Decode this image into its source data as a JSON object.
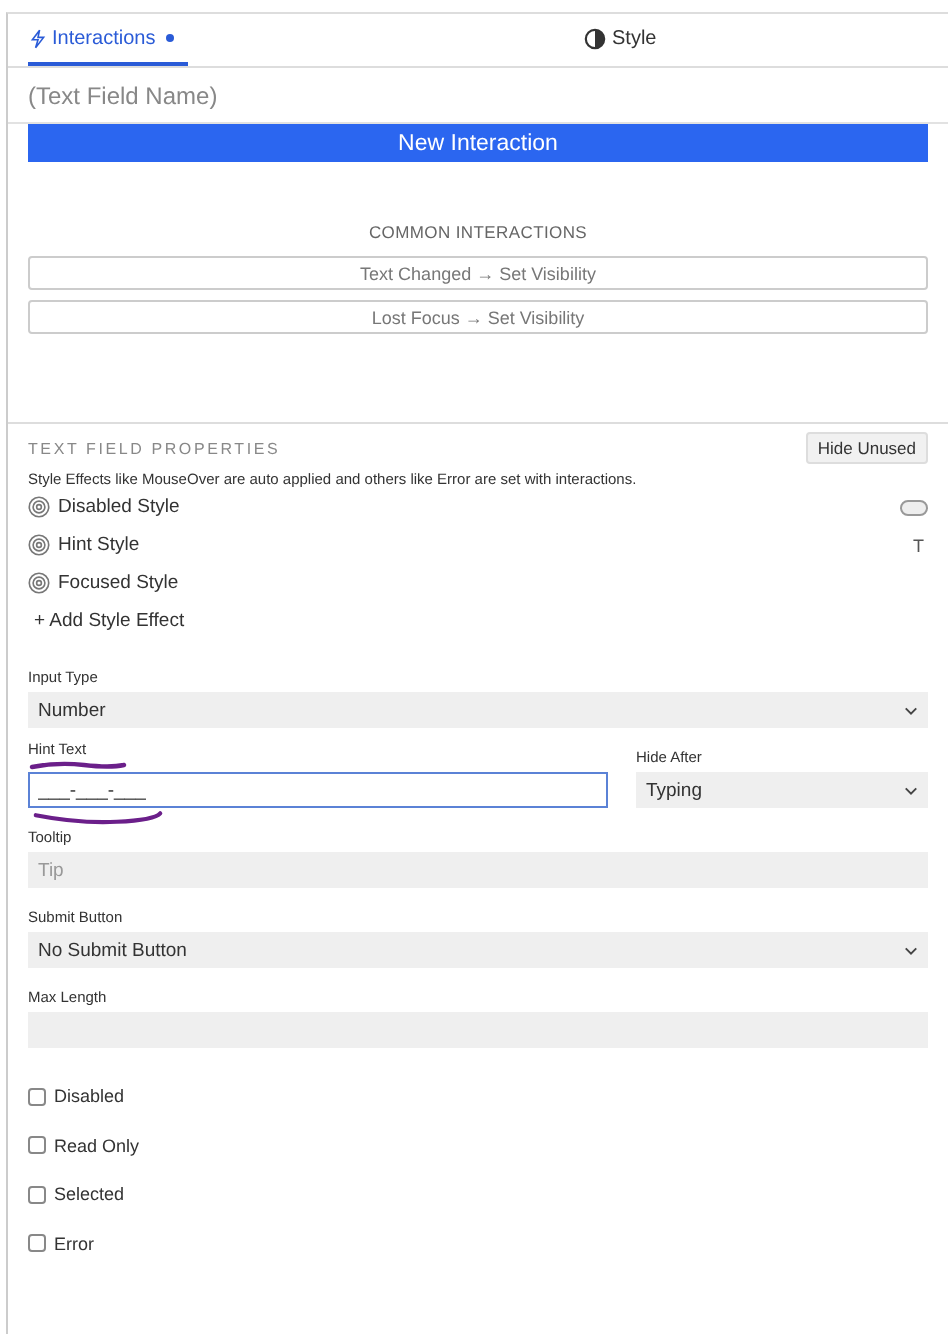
{
  "tabs": [
    {
      "label": "Interactions",
      "dot": true,
      "selected": true
    },
    {
      "label": "Style",
      "dot": false,
      "selected": false
    }
  ],
  "component_name": {
    "placeholder": "(Text Field Name)"
  },
  "new_interaction_button": "New Interaction",
  "common_interactions": {
    "title": "COMMON INTERACTIONS",
    "items": [
      "Text Changed → Set Visibility",
      "Lost Focus → Set Visibility"
    ]
  },
  "properties": {
    "title": "TEXT FIELD PROPERTIES",
    "hide_unused_button": "Hide Unused",
    "description": "Style Effects like MouseOver are auto applied and others like Error are set with interactions.",
    "style_effects": [
      {
        "label": "Disabled Style",
        "kind": "pill"
      },
      {
        "label": "Hint Style",
        "kind": "text",
        "indicator": "T"
      },
      {
        "label": "Focused Style",
        "kind": "none"
      }
    ],
    "add_style_effect": "+ Add Style Effect"
  },
  "fields": [
    {
      "kind": "select",
      "label": "Input Type",
      "value": "Number"
    },
    {
      "kind": "pair",
      "items": [
        {
          "kind": "input",
          "label": "Hint Text",
          "value": "___-___-___",
          "focused": true,
          "annotated": true
        },
        {
          "kind": "select",
          "label": "Hide After",
          "value": "Typing"
        }
      ]
    },
    {
      "kind": "input",
      "label": "Tooltip",
      "placeholder": "Tip",
      "focused": false
    },
    {
      "kind": "select",
      "label": "Submit Button",
      "value": "No Submit Button"
    },
    {
      "kind": "input",
      "label": "Max Length",
      "focused": false
    }
  ],
  "checkboxes": [
    {
      "label": "Disabled",
      "checked": false
    },
    {
      "label": "Read Only",
      "checked": false
    },
    {
      "label": "Selected",
      "checked": false
    },
    {
      "label": "Error",
      "checked": false
    }
  ]
}
